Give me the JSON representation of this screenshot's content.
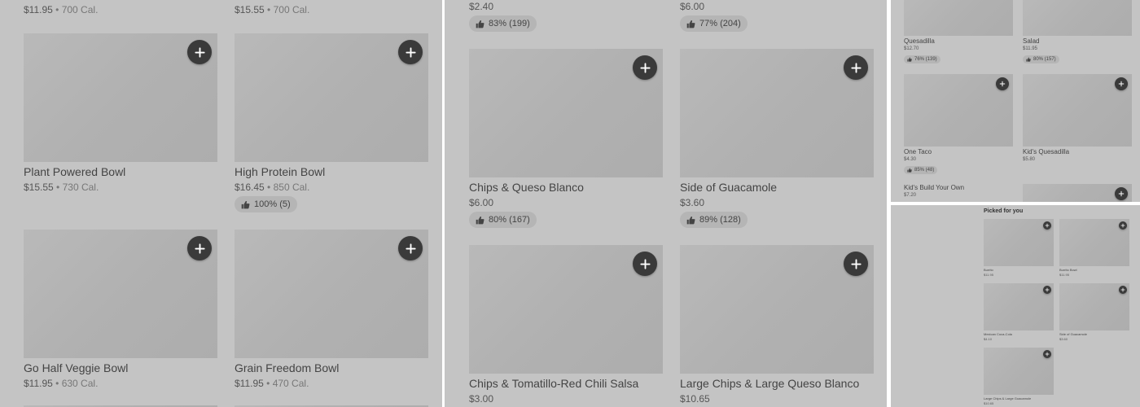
{
  "panel1": {
    "top_items": [
      {
        "price": "$11.95",
        "calories": "700 Cal."
      },
      {
        "price": "$15.55",
        "calories": "700 Cal."
      }
    ],
    "items": [
      {
        "name": "Plant Powered Bowl",
        "price": "$15.55",
        "calories": "730 Cal.",
        "rating": ""
      },
      {
        "name": "High Protein Bowl",
        "price": "$16.45",
        "calories": "850 Cal.",
        "rating": "100% (5)"
      },
      {
        "name": "Go Half Veggie Bowl",
        "price": "$11.95",
        "calories": "630 Cal.",
        "rating": ""
      },
      {
        "name": "Grain Freedom Bowl",
        "price": "$11.95",
        "calories": "470 Cal.",
        "rating": ""
      }
    ]
  },
  "panel2": {
    "top_items": [
      {
        "price": "$2.40",
        "rating": "83% (199)"
      },
      {
        "price": "$6.00",
        "rating": "77% (204)"
      }
    ],
    "items": [
      {
        "name": "Chips & Queso Blanco",
        "price": "$6.00",
        "rating": "80% (167)"
      },
      {
        "name": "Side of Guacamole",
        "price": "$3.60",
        "rating": "89% (128)"
      },
      {
        "name": "Chips & Tomatillo-Red Chili Salsa",
        "price": "$3.00",
        "rating": ""
      },
      {
        "name": "Large Chips & Large Queso Blanco",
        "price": "$10.65",
        "rating": ""
      }
    ]
  },
  "panel3": {
    "items": [
      {
        "name": "Quesadilla",
        "price": "$12.70",
        "rating": "76% (139)"
      },
      {
        "name": "Salad",
        "price": "$11.95",
        "rating": "80% (157)"
      },
      {
        "name": "One Taco",
        "price": "$4.30",
        "rating": "85% (48)"
      },
      {
        "name": "Kid's Quesadilla",
        "price": "$5.80",
        "rating": ""
      },
      {
        "name": "Kid's Build Your Own",
        "price": "$7.20",
        "rating": ""
      }
    ]
  },
  "panel4": {
    "title": "Picked for you",
    "items": [
      {
        "name": "Burrito",
        "price": "$11.95"
      },
      {
        "name": "Burrito Bowl",
        "price": "$11.95"
      },
      {
        "name": "Mexican Coca-Cola",
        "price": "$4.10"
      },
      {
        "name": "Side of Guacamole",
        "price": "$3.60"
      },
      {
        "name": "Large Chips & Large Guacamole",
        "price": "$10.65"
      }
    ]
  },
  "icons": {
    "add": "plus-icon",
    "rating": "thumbs-up-icon"
  },
  "colors": {
    "panel_bg": "#c4c4c4",
    "image_placeholder": "#b3b3b3",
    "add_button": "#3a3a3a",
    "badge_bg": "#b5b5b5"
  },
  "separator": "•"
}
